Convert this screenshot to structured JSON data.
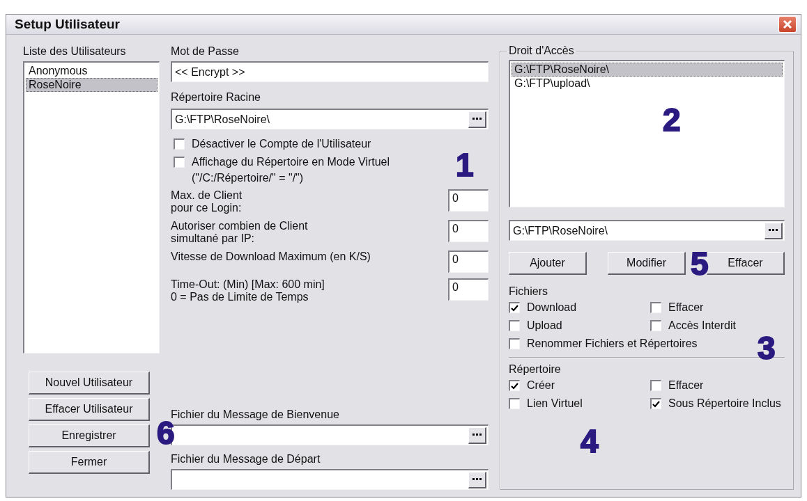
{
  "window": {
    "title": "Setup Utilisateur"
  },
  "users": {
    "label": "Liste des Utilisateurs",
    "items": [
      {
        "label": "Anonymous",
        "selected": false
      },
      {
        "label": "RoseNoire",
        "selected": true
      }
    ],
    "buttons": [
      "Nouvel Utilisateur",
      "Effacer Utilisateur",
      "Enregistrer",
      "Fermer"
    ],
    "marker": "6"
  },
  "password": {
    "label": "Mot de Passe",
    "value": "<< Encrypt >>"
  },
  "root_dir": {
    "label": "Répertoire Racine",
    "value": "G:\\FTP\\RoseNoire\\"
  },
  "account": {
    "marker": "1",
    "options": [
      {
        "label": "Désactiver le Compte de l'Utilisateur",
        "checked": false
      },
      {
        "label": "Affichage du Répertoire en Mode Virtuel",
        "checked": false
      }
    ],
    "note": "(\"/C:/Répertoire/\" = \"/\")"
  },
  "limits": [
    {
      "lines": [
        "Max. de Client",
        "pour ce Login:"
      ],
      "value": "0"
    },
    {
      "lines": [
        "Autoriser combien de Client",
        "simultané par IP:"
      ],
      "value": "0"
    },
    {
      "lines": [
        "Vitesse de Download Maximum (en K/S)"
      ],
      "value": "0"
    },
    {
      "lines": [
        "Time-Out: (Min) [Max: 600 min]",
        "0 = Pas de Limite de Temps"
      ],
      "value": "0"
    }
  ],
  "message_files": [
    {
      "label": "Fichier du Message de Bienvenue"
    },
    {
      "label": "Fichier du Message de Départ"
    }
  ],
  "access": {
    "label": "Droit d'Accès",
    "marker": "2",
    "paths": [
      {
        "label": "G:\\FTP\\RoseNoire\\",
        "selected": true
      },
      {
        "label": "G:\\FTP\\upload\\",
        "selected": false
      }
    ],
    "path_value": "G:\\FTP\\RoseNoire\\",
    "buttons": [
      "Ajouter",
      "Modifier",
      "Effacer"
    ],
    "buttons_marker": "5"
  },
  "files": {
    "label": "Fichiers",
    "marker": "3",
    "options": [
      {
        "label": "Download",
        "checked": true
      },
      {
        "label": "Effacer",
        "checked": false
      },
      {
        "label": "Upload",
        "checked": false
      },
      {
        "label": "Accès Interdit",
        "checked": false
      },
      {
        "label": "Renommer Fichiers et Répertoires",
        "checked": false
      }
    ]
  },
  "directory": {
    "label": "Répertoire",
    "marker": "4",
    "options": [
      {
        "label": "Créer",
        "checked": true
      },
      {
        "label": "Effacer",
        "checked": false
      },
      {
        "label": "Lien Virtuel",
        "checked": false
      },
      {
        "label": "Sous Répertoire Inclus",
        "checked": true
      }
    ]
  }
}
